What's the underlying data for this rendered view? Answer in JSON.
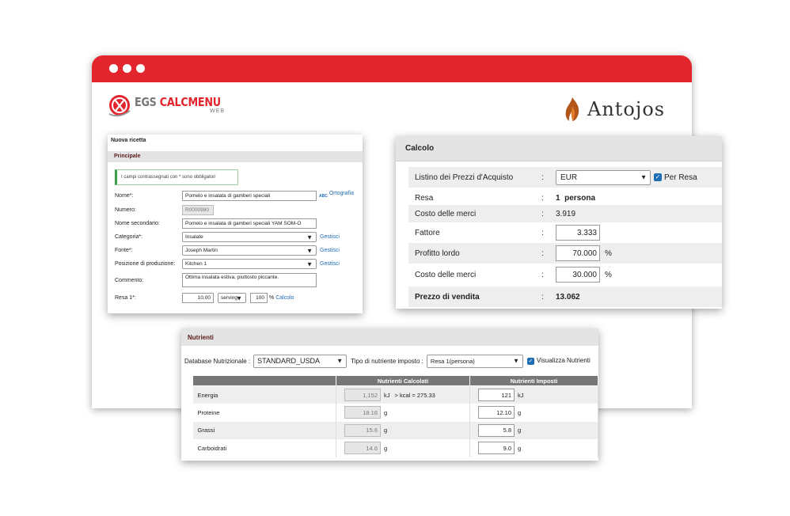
{
  "brand_left": {
    "name_gray": "EGS ",
    "name_red": "CALCMENU",
    "sub": "WEB"
  },
  "brand_right": {
    "name": "Antojos"
  },
  "recipe": {
    "title": "Nuova ricetta",
    "section": "Principale",
    "notice": "I campi contrassegnati con * sono obbligatori",
    "fields": {
      "nome": {
        "label": "Nome*:",
        "value": "Pomelo e insalata di gamberi speciali",
        "link": "Ortografia",
        "spell_icon_text": "ABC"
      },
      "numero": {
        "label": "Numero:",
        "value": "R0000980"
      },
      "nome_secondario": {
        "label": "Nome secondario:",
        "value": "Pomelo e insalata di gamberi speciali YAM SOM-O"
      },
      "categoria": {
        "label": "Categoria*:",
        "value": "Insalate",
        "link": "Gestisci"
      },
      "fonte": {
        "label": "Fonte*:",
        "value": "Joseph Martin",
        "link": "Gestisci"
      },
      "posizione": {
        "label": "Posizione di produzione:",
        "value": "Kitchen 1",
        "link": "Gestisci"
      },
      "commento": {
        "label": "Commento:",
        "value": "Ottima insalata estiva, piuttosto piccante."
      },
      "resa": {
        "label": "Resa 1*:",
        "value": "10.00",
        "unit": "serving",
        "percent": "100",
        "percent_sign": "%",
        "link": "Calcolo"
      }
    }
  },
  "calcolo": {
    "title": "Calcolo",
    "colon": ":",
    "rows": {
      "listino": {
        "label": "Listino dei Prezzi d'Acquisto",
        "value": "EUR",
        "checkbox": "Per Resa",
        "checked": true
      },
      "resa": {
        "label": "Resa",
        "value": "1  persona"
      },
      "costo1": {
        "label": "Costo delle merci",
        "value": "3.919"
      },
      "fattore": {
        "label": "Fattore",
        "value": "3.333"
      },
      "profitto": {
        "label": "Profitto lordo",
        "value": "70.000",
        "unit": "%"
      },
      "costo2": {
        "label": "Costo delle merci",
        "value": "30.000",
        "unit": "%"
      },
      "prezzo": {
        "label": "Prezzo di vendita",
        "value": "13.062"
      }
    }
  },
  "nutrienti": {
    "title": "Nutrienti",
    "db_label": "Database Nutrizionale :",
    "db_value": "STANDARD_USDA",
    "tipo_label": "Tipo di nutriente imposto :",
    "tipo_value": "Resa 1(persona)",
    "show_label": "Visualizza Nutrienti",
    "show_checked": true,
    "col_calc": "Nutrienti Calcolati",
    "col_imp": "Nutrienti Imposti",
    "rows": [
      {
        "name": "Energia",
        "calc": "1,152",
        "unit": "kJ",
        "extra": "> kcal = 275.33",
        "imp": "121",
        "imp_unit": "kJ"
      },
      {
        "name": "Proteine",
        "calc": "18.16",
        "unit": "g",
        "extra": "",
        "imp": "12.10",
        "imp_unit": "g"
      },
      {
        "name": "Grassi",
        "calc": "15.6",
        "unit": "g",
        "extra": "",
        "imp": "5.8",
        "imp_unit": "g"
      },
      {
        "name": "Carboidrati",
        "calc": "14.6",
        "unit": "g",
        "extra": "",
        "imp": "9.0",
        "imp_unit": "g"
      }
    ]
  },
  "colors": {
    "accent_red": "#e3262e",
    "link_blue": "#1f6db5",
    "header_gray": "#e4e4e4",
    "table_header": "#777777"
  }
}
